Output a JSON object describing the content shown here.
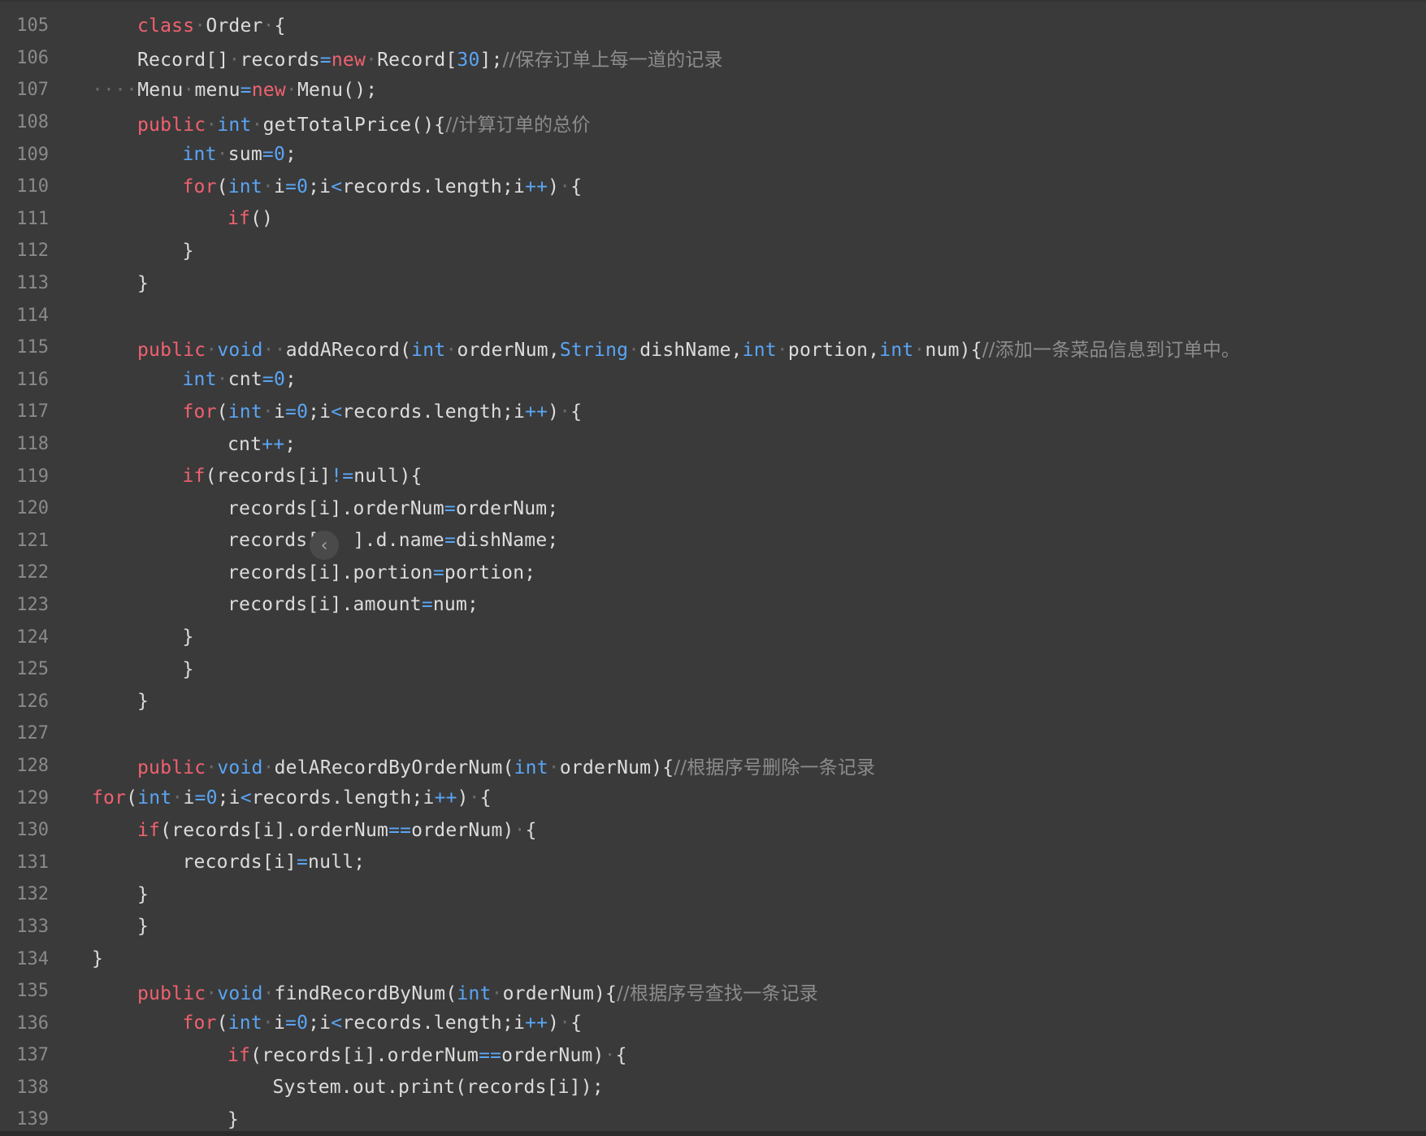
{
  "editor": {
    "lines": [
      {
        "num": "105",
        "indent": 1,
        "tokens": [
          [
            "kw",
            "class"
          ],
          [
            "ws",
            "·"
          ],
          [
            "tok",
            "Order"
          ],
          [
            "ws",
            "·"
          ],
          [
            "tok",
            "{"
          ]
        ]
      },
      {
        "num": "106",
        "indent": 1,
        "tokens": [
          [
            "tok",
            "Record[]"
          ],
          [
            "ws",
            "·"
          ],
          [
            "tok",
            "records"
          ],
          [
            "op",
            "="
          ],
          [
            "kw",
            "new"
          ],
          [
            "ws",
            "·"
          ],
          [
            "tok",
            "Record["
          ],
          [
            "num",
            "30"
          ],
          [
            "tok",
            "];"
          ],
          [
            "cm",
            "//保存订单上每一道的记录"
          ]
        ]
      },
      {
        "num": "107",
        "indent": 0,
        "tokens": [
          [
            "ws",
            "····"
          ],
          [
            "tok",
            "Menu"
          ],
          [
            "ws",
            "·"
          ],
          [
            "tok",
            "menu"
          ],
          [
            "op",
            "="
          ],
          [
            "kw",
            "new"
          ],
          [
            "ws",
            "·"
          ],
          [
            "tok",
            "Menu();"
          ]
        ]
      },
      {
        "num": "108",
        "indent": 1,
        "tokens": [
          [
            "kw",
            "public"
          ],
          [
            "ws",
            "·"
          ],
          [
            "ty",
            "int"
          ],
          [
            "ws",
            "·"
          ],
          [
            "tok",
            "getTotalPrice(){"
          ],
          [
            "cm",
            "//计算订单的总价"
          ]
        ]
      },
      {
        "num": "109",
        "indent": 2,
        "tokens": [
          [
            "ty",
            "int"
          ],
          [
            "ws",
            "·"
          ],
          [
            "tok",
            "sum"
          ],
          [
            "op",
            "="
          ],
          [
            "num",
            "0"
          ],
          [
            "tok",
            ";"
          ]
        ]
      },
      {
        "num": "110",
        "indent": 2,
        "tokens": [
          [
            "kw",
            "for"
          ],
          [
            "tok",
            "("
          ],
          [
            "ty",
            "int"
          ],
          [
            "ws",
            "·"
          ],
          [
            "tok",
            "i"
          ],
          [
            "op",
            "="
          ],
          [
            "num",
            "0"
          ],
          [
            "tok",
            ";i"
          ],
          [
            "op",
            "<"
          ],
          [
            "tok",
            "records.length;i"
          ],
          [
            "op",
            "++"
          ],
          [
            "tok",
            ")"
          ],
          [
            "ws",
            "·"
          ],
          [
            "tok",
            "{"
          ]
        ]
      },
      {
        "num": "111",
        "indent": 3,
        "tokens": [
          [
            "kw",
            "if"
          ],
          [
            "tok",
            "()"
          ]
        ]
      },
      {
        "num": "112",
        "indent": 2,
        "tokens": [
          [
            "tok",
            "}"
          ]
        ]
      },
      {
        "num": "113",
        "indent": 1,
        "tokens": [
          [
            "tok",
            "}"
          ]
        ]
      },
      {
        "num": "114",
        "indent": 0,
        "tokens": []
      },
      {
        "num": "115",
        "indent": 1,
        "tokens": [
          [
            "kw",
            "public"
          ],
          [
            "ws",
            "·"
          ],
          [
            "ty",
            "void"
          ],
          [
            "ws",
            "·"
          ],
          [
            "ws",
            "·"
          ],
          [
            "tok",
            "addARecord("
          ],
          [
            "ty",
            "int"
          ],
          [
            "ws",
            "·"
          ],
          [
            "tok",
            "orderNum,"
          ],
          [
            "ty",
            "String"
          ],
          [
            "ws",
            "·"
          ],
          [
            "tok",
            "dishName,"
          ],
          [
            "ty",
            "int"
          ],
          [
            "ws",
            "·"
          ],
          [
            "tok",
            "portion,"
          ],
          [
            "ty",
            "int"
          ],
          [
            "ws",
            "·"
          ],
          [
            "tok",
            "num){"
          ],
          [
            "cm",
            "//添加一条菜品信息到订单中。"
          ]
        ]
      },
      {
        "num": "116",
        "indent": 2,
        "tokens": [
          [
            "ty",
            "int"
          ],
          [
            "ws",
            "·"
          ],
          [
            "tok",
            "cnt"
          ],
          [
            "op",
            "="
          ],
          [
            "num",
            "0"
          ],
          [
            "tok",
            ";"
          ]
        ]
      },
      {
        "num": "117",
        "indent": 2,
        "tokens": [
          [
            "kw",
            "for"
          ],
          [
            "tok",
            "("
          ],
          [
            "ty",
            "int"
          ],
          [
            "ws",
            "·"
          ],
          [
            "tok",
            "i"
          ],
          [
            "op",
            "="
          ],
          [
            "num",
            "0"
          ],
          [
            "tok",
            ";i"
          ],
          [
            "op",
            "<"
          ],
          [
            "tok",
            "records.length;i"
          ],
          [
            "op",
            "++"
          ],
          [
            "tok",
            ")"
          ],
          [
            "ws",
            "·"
          ],
          [
            "tok",
            "{"
          ]
        ]
      },
      {
        "num": "118",
        "indent": 3,
        "tokens": [
          [
            "tok",
            "cnt"
          ],
          [
            "op",
            "++"
          ],
          [
            "tok",
            ";"
          ]
        ]
      },
      {
        "num": "119",
        "indent": 2,
        "tokens": [
          [
            "kw",
            "if"
          ],
          [
            "tok",
            "(records[i]"
          ],
          [
            "op",
            "!="
          ],
          [
            "tok",
            "null){"
          ]
        ]
      },
      {
        "num": "120",
        "indent": 3,
        "tokens": [
          [
            "tok",
            "records[i].orderNum"
          ],
          [
            "op",
            "="
          ],
          [
            "tok",
            "orderNum;"
          ]
        ]
      },
      {
        "num": "121",
        "indent": 3,
        "tokens": [
          [
            "tok",
            "records["
          ],
          [
            "tok",
            "   "
          ],
          [
            "tok",
            "].d.name"
          ],
          [
            "op",
            "="
          ],
          [
            "tok",
            "dishName;"
          ]
        ]
      },
      {
        "num": "122",
        "indent": 3,
        "tokens": [
          [
            "tok",
            "records[i].portion"
          ],
          [
            "op",
            "="
          ],
          [
            "tok",
            "portion;"
          ]
        ]
      },
      {
        "num": "123",
        "indent": 3,
        "tokens": [
          [
            "tok",
            "records[i].amount"
          ],
          [
            "op",
            "="
          ],
          [
            "tok",
            "num;"
          ]
        ]
      },
      {
        "num": "124",
        "indent": 2,
        "tokens": [
          [
            "tok",
            "}"
          ]
        ]
      },
      {
        "num": "125",
        "indent": 2,
        "tokens": [
          [
            "tok",
            "}"
          ]
        ]
      },
      {
        "num": "126",
        "indent": 1,
        "tokens": [
          [
            "tok",
            "}"
          ]
        ]
      },
      {
        "num": "127",
        "indent": 0,
        "tokens": []
      },
      {
        "num": "128",
        "indent": 1,
        "tokens": [
          [
            "kw",
            "public"
          ],
          [
            "ws",
            "·"
          ],
          [
            "ty",
            "void"
          ],
          [
            "ws",
            "·"
          ],
          [
            "tok",
            "delARecordByOrderNum("
          ],
          [
            "ty",
            "int"
          ],
          [
            "ws",
            "·"
          ],
          [
            "tok",
            "orderNum){"
          ],
          [
            "cm",
            "//根据序号删除一条记录"
          ]
        ]
      },
      {
        "num": "129",
        "indent": 0,
        "tokens": [
          [
            "kw",
            "for"
          ],
          [
            "tok",
            "("
          ],
          [
            "ty",
            "int"
          ],
          [
            "ws",
            "·"
          ],
          [
            "tok",
            "i"
          ],
          [
            "op",
            "="
          ],
          [
            "num",
            "0"
          ],
          [
            "tok",
            ";i"
          ],
          [
            "op",
            "<"
          ],
          [
            "tok",
            "records.length;i"
          ],
          [
            "op",
            "++"
          ],
          [
            "tok",
            ")"
          ],
          [
            "ws",
            "·"
          ],
          [
            "tok",
            "{"
          ]
        ]
      },
      {
        "num": "130",
        "indent": 1,
        "tokens": [
          [
            "kw",
            "if"
          ],
          [
            "tok",
            "(records[i].orderNum"
          ],
          [
            "op",
            "=="
          ],
          [
            "tok",
            "orderNum)"
          ],
          [
            "ws",
            "·"
          ],
          [
            "tok",
            "{"
          ]
        ]
      },
      {
        "num": "131",
        "indent": 2,
        "tokens": [
          [
            "tok",
            "records[i]"
          ],
          [
            "op",
            "="
          ],
          [
            "tok",
            "null;"
          ]
        ]
      },
      {
        "num": "132",
        "indent": 1,
        "tokens": [
          [
            "tok",
            "}"
          ]
        ]
      },
      {
        "num": "133",
        "indent": 1,
        "tokens": [
          [
            "tok",
            "}"
          ]
        ]
      },
      {
        "num": "134",
        "indent": 0,
        "tokens": [
          [
            "tok",
            "}"
          ]
        ]
      },
      {
        "num": "135",
        "indent": 1,
        "tokens": [
          [
            "kw",
            "public"
          ],
          [
            "ws",
            "·"
          ],
          [
            "ty",
            "void"
          ],
          [
            "ws",
            "·"
          ],
          [
            "tok",
            "findRecordByNum("
          ],
          [
            "ty",
            "int"
          ],
          [
            "ws",
            "·"
          ],
          [
            "tok",
            "orderNum){"
          ],
          [
            "cm",
            "//根据序号查找一条记录"
          ]
        ]
      },
      {
        "num": "136",
        "indent": 2,
        "tokens": [
          [
            "kw",
            "for"
          ],
          [
            "tok",
            "("
          ],
          [
            "ty",
            "int"
          ],
          [
            "ws",
            "·"
          ],
          [
            "tok",
            "i"
          ],
          [
            "op",
            "="
          ],
          [
            "num",
            "0"
          ],
          [
            "tok",
            ";i"
          ],
          [
            "op",
            "<"
          ],
          [
            "tok",
            "records.length;i"
          ],
          [
            "op",
            "++"
          ],
          [
            "tok",
            ")"
          ],
          [
            "ws",
            "·"
          ],
          [
            "tok",
            "{"
          ]
        ]
      },
      {
        "num": "137",
        "indent": 3,
        "tokens": [
          [
            "kw",
            "if"
          ],
          [
            "tok",
            "(records[i].orderNum"
          ],
          [
            "op",
            "=="
          ],
          [
            "tok",
            "orderNum)"
          ],
          [
            "ws",
            "·"
          ],
          [
            "tok",
            "{"
          ]
        ]
      },
      {
        "num": "138",
        "indent": 4,
        "tokens": [
          [
            "tok",
            "System.out.print(records[i]);"
          ]
        ]
      },
      {
        "num": "139",
        "indent": 3,
        "tokens": [
          [
            "tok",
            "}"
          ]
        ]
      }
    ],
    "fold_button_icon": "chevron-left-icon",
    "fold_button_glyph": "‹"
  }
}
